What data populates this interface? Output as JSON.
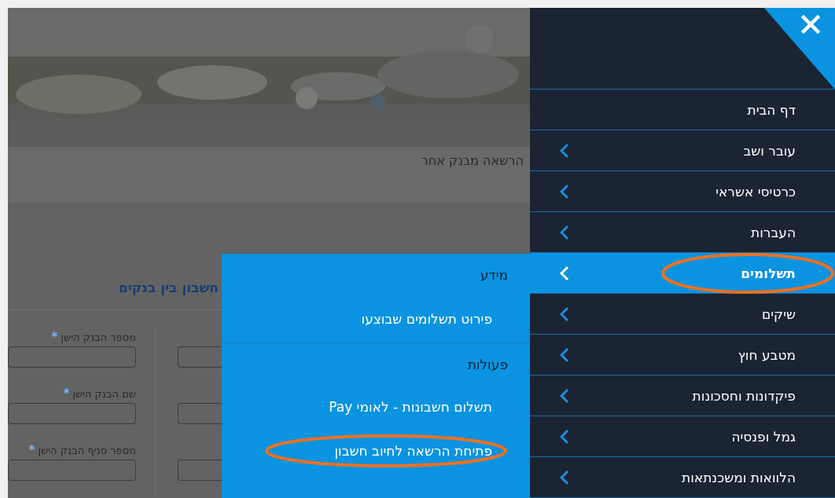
{
  "breadcrumb": "הרשאה מבנק אחר",
  "section_title": "חשבון בין בנקים",
  "form_fields": [
    {
      "marker": "*",
      "label": "מספר הבנק הישן"
    },
    {
      "marker": "*",
      "label": "שם הבנק הישן"
    },
    {
      "marker": "*",
      "label": "מספר סניף הבנק הישן"
    }
  ],
  "nav": {
    "items": [
      {
        "label": "דף הבית",
        "has_submenu": false,
        "selected": false,
        "circled": false
      },
      {
        "label": "עובר ושב",
        "has_submenu": true,
        "selected": false,
        "circled": false
      },
      {
        "label": "כרטיסי אשראי",
        "has_submenu": true,
        "selected": false,
        "circled": false
      },
      {
        "label": "העברות",
        "has_submenu": true,
        "selected": false,
        "circled": false
      },
      {
        "label": "תשלומים",
        "has_submenu": true,
        "selected": true,
        "circled": true
      },
      {
        "label": "שיקים",
        "has_submenu": true,
        "selected": false,
        "circled": false
      },
      {
        "label": "מטבע חוץ",
        "has_submenu": true,
        "selected": false,
        "circled": false
      },
      {
        "label": "פיקדונות וחסכונות",
        "has_submenu": true,
        "selected": false,
        "circled": false
      },
      {
        "label": "גמל ופנסיה",
        "has_submenu": true,
        "selected": false,
        "circled": false
      },
      {
        "label": "הלוואות ומשכנתאות",
        "has_submenu": true,
        "selected": false,
        "circled": false
      }
    ]
  },
  "submenu": {
    "items": [
      {
        "kind": "heading",
        "label": "מידע"
      },
      {
        "kind": "link",
        "label": "פירוט תשלומים שבוצעו",
        "circled": false
      },
      {
        "kind": "heading",
        "label": "פעולות"
      },
      {
        "kind": "link",
        "label": "תשלום חשבונות - לאומי Pay",
        "circled": false
      },
      {
        "kind": "link",
        "label": "פתיחת הרשאה לחיוב חשבון",
        "circled": true
      }
    ]
  }
}
